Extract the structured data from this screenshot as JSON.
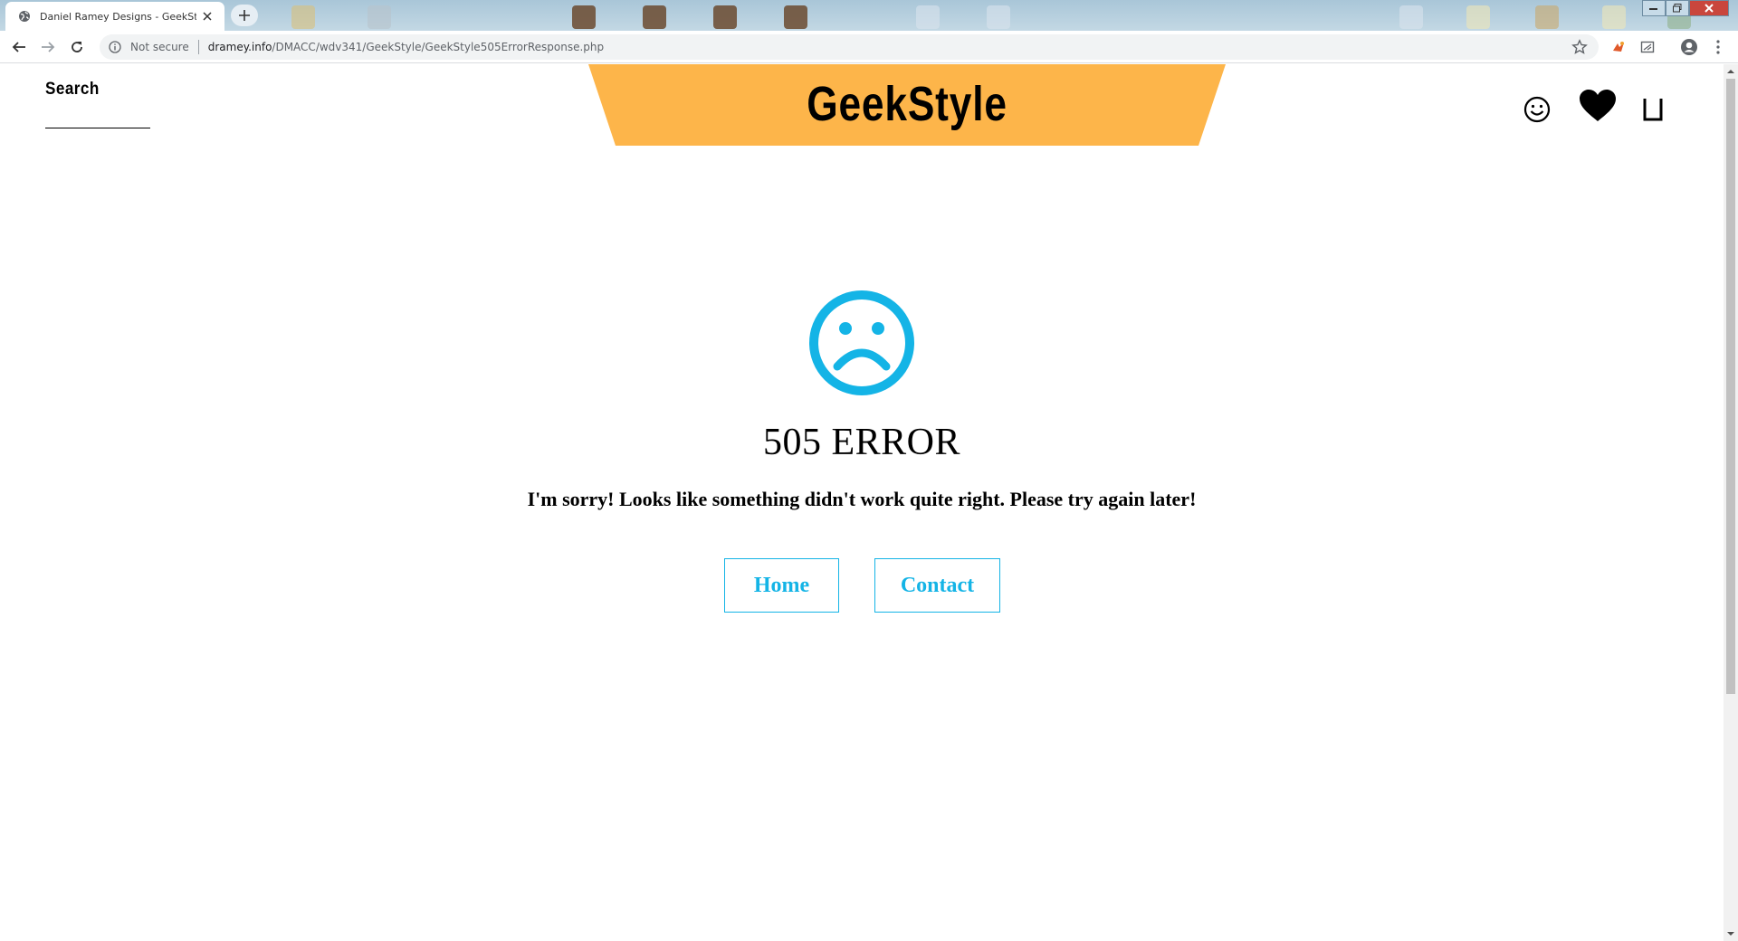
{
  "browser": {
    "tab_title": "Daniel Ramey Designs - GeekSty",
    "security_label": "Not secure",
    "url_host": "dramey.info",
    "url_path": "/DMACC/wdv341/GeekStyle/GeekStyle505ErrorResponse.php"
  },
  "header": {
    "search_label": "Search",
    "logo_text": "GeekStyle",
    "banner_color": "#fdb54a",
    "icons": [
      "smiley-icon",
      "heart-icon",
      "bag-icon"
    ]
  },
  "error": {
    "title": "505 ERROR",
    "message": "I'm sorry! Looks like something didn't work quite right. Please try again later!",
    "icon": "sad-face-icon",
    "accent_color": "#14b4e6"
  },
  "buttons": {
    "home_label": "Home",
    "contact_label": "Contact"
  }
}
